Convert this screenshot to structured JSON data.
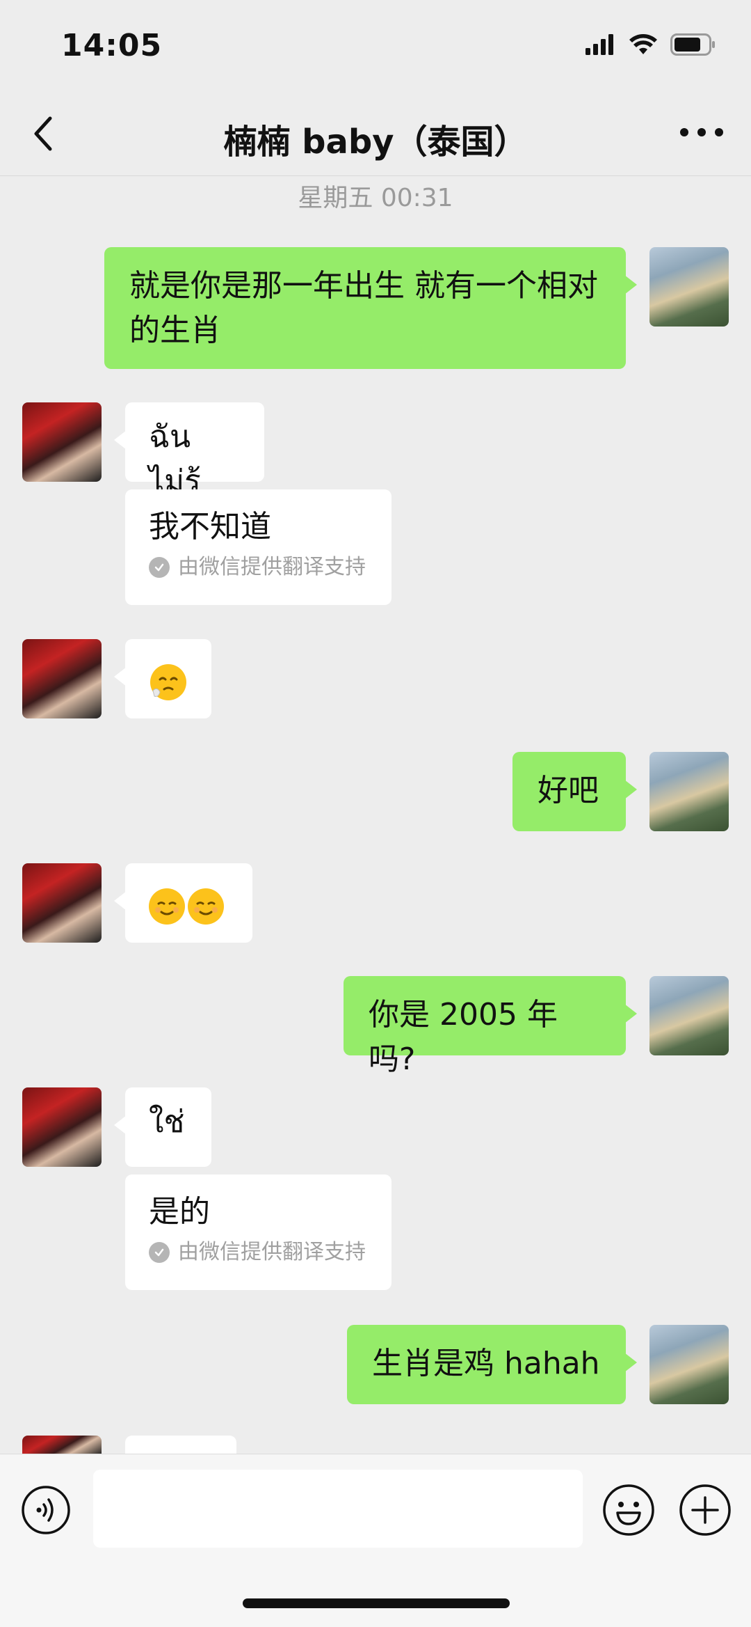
{
  "status_bar": {
    "time": "14:05",
    "icons": [
      "signal-icon",
      "wifi-icon",
      "battery-icon"
    ]
  },
  "header": {
    "title": "楠楠 baby（泰国）",
    "back_icon": "chevron-left-icon",
    "more_icon": "more-dots-icon"
  },
  "chat": {
    "timestamp": "星期五 00:31",
    "messages": [
      {
        "from": "self",
        "text": "就是你是那一年出生 就有一个相对的生肖"
      },
      {
        "from": "other",
        "text": "ฉันไม่รู้",
        "translation": "我不知道",
        "translation_note": "由微信提供翻译支持"
      },
      {
        "from": "other",
        "emoji": [
          "relieved-face-emoji"
        ]
      },
      {
        "from": "self",
        "text": "好吧"
      },
      {
        "from": "other",
        "emoji": [
          "smiling-face-emoji",
          "smiling-face-emoji"
        ]
      },
      {
        "from": "self",
        "text": "你是 2005 年吗?"
      },
      {
        "from": "other",
        "text": "ใช่",
        "translation": "是的",
        "translation_note": "由微信提供翻译支持"
      },
      {
        "from": "self",
        "text": "生肖是鸡 hahah"
      }
    ]
  },
  "input_bar": {
    "voice_icon": "voice-icon",
    "emoji_icon": "emoji-icon",
    "plus_icon": "plus-icon",
    "placeholder": ""
  },
  "colors": {
    "background": "#ededed",
    "self_bubble": "#95ec69",
    "other_bubble": "#ffffff",
    "timestamp": "#9a9a9a"
  }
}
